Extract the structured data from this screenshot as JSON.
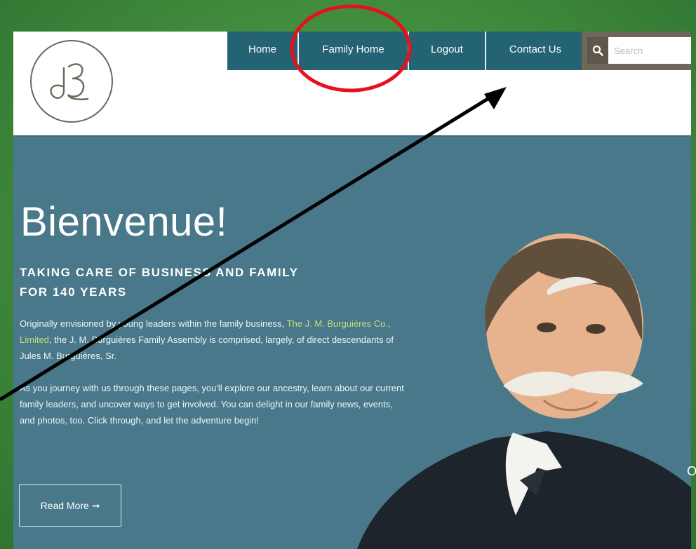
{
  "nav": {
    "items": [
      "Home",
      "Family Home",
      "Logout",
      "Contact Us"
    ]
  },
  "search": {
    "placeholder": "Search"
  },
  "hero": {
    "title": "Bienvenue!",
    "subtitle_line1": "TAKING CARE OF BUSINESS AND FAMILY",
    "subtitle_line2": "FOR 140 YEARS",
    "para1_prefix": "Originally envisioned by young leaders within the family business, ",
    "para1_link": "The J. M. Burguières Co., Limited",
    "para1_suffix": ", the J. M. Burguières Family Assembly is comprised, largely, of direct descendants of Jules M. Burguières, Sr.",
    "para2": "As you journey with us through these pages, you'll explore our ancestry, learn about our current family leaders, and uncover ways to get involved. You can delight in our family news, events, and photos, too. Click through, and let the adventure begin!",
    "read_more": "Read More ➞"
  },
  "annotation": {
    "highlight": "Family Home",
    "arrow_target": "Contact Us"
  },
  "edge_glyph": "O",
  "colors": {
    "background_green": "#4e9a47",
    "nav_teal": "#236373",
    "hero_teal": "#48788a",
    "search_brown": "#6f6759",
    "link_yellow_green": "#c9dc7a",
    "annotation_red": "#e8101a",
    "arrow_black": "#000000"
  },
  "icons": {
    "logo": "jb-monogram-logo",
    "search": "search-icon",
    "portrait": "portrait-photo"
  }
}
